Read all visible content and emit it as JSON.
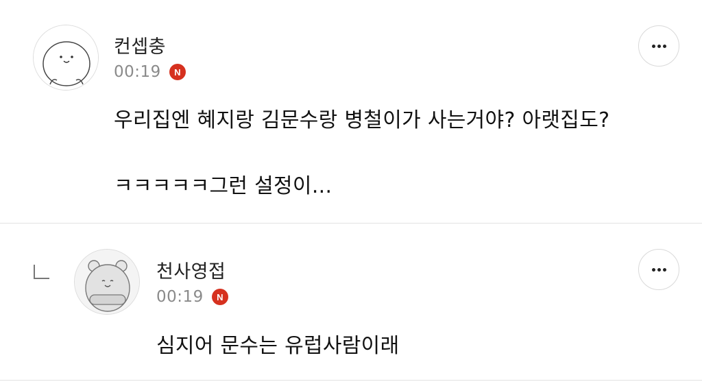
{
  "comments": [
    {
      "username": "컨셉충",
      "time": "00:19",
      "badge": "N",
      "avatar_icon": "cat-face-avatar-icon",
      "lines": [
        "우리집엔 혜지랑 김문수랑 병철이가 사는거야? 아랫집도?",
        "ㅋㅋㅋㅋㅋ그런 설정이..."
      ],
      "more_icon": "more-dots-icon"
    },
    {
      "username": "천사영접",
      "time": "00:19",
      "badge": "N",
      "avatar_icon": "hamster-avatar-icon",
      "reply_icon": "reply-arrow-icon",
      "lines": [
        "심지어 문수는 유럽사람이래"
      ],
      "more_icon": "more-dots-icon"
    }
  ],
  "colors": {
    "badge": "#d6311f",
    "time": "#8a8a8a",
    "divider": "#e2e2e2"
  }
}
